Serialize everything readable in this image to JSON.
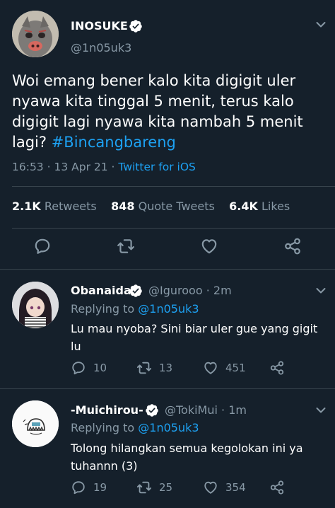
{
  "main_tweet": {
    "display_name": "INOSUKE",
    "handle": "@1n05uk3",
    "text": "Woi emang bener kalo kita digigit uler nyawa kita tinggal 5 menit, terus kalo digigit lagi nyawa kita nambah 5 menit lagi?",
    "hashtag": "#Bincangbareng",
    "time": "16:53",
    "date": "13 Apr 21",
    "source": "Twitter for iOS",
    "stats": {
      "retweets_count": "2.1K",
      "retweets_label": "Retweets",
      "quotes_count": "848",
      "quotes_label": "Quote Tweets",
      "likes_count": "6.4K",
      "likes_label": "Likes"
    }
  },
  "replies": [
    {
      "display_name": "Obanaida",
      "handle": "@Igurooo",
      "time": "2m",
      "replying_prefix": "Replying to",
      "replying_to": "@1n05uk3",
      "text": "Lu mau nyoba? Sini biar uler gue yang gigit lu",
      "replies": "10",
      "retweets": "13",
      "likes": "451"
    },
    {
      "display_name": "-Muichirou-",
      "handle": "@TokiMui",
      "time": "1m",
      "replying_prefix": "Replying to",
      "replying_to": "@1n05uk3",
      "text": "Tolong hilangkan semua kegolokan ini ya tuhannn (3)",
      "replies": "19",
      "retweets": "25",
      "likes": "354"
    }
  ],
  "separators": {
    "dot": "·"
  },
  "colors": {
    "background": "#15202b",
    "text": "#ffffff",
    "secondary": "#8899a6",
    "accent": "#1da1f2",
    "divider": "#38444d"
  },
  "icons": [
    "verified-badge-icon",
    "chevron-down-icon",
    "reply-icon",
    "retweet-icon",
    "like-icon",
    "share-icon"
  ]
}
